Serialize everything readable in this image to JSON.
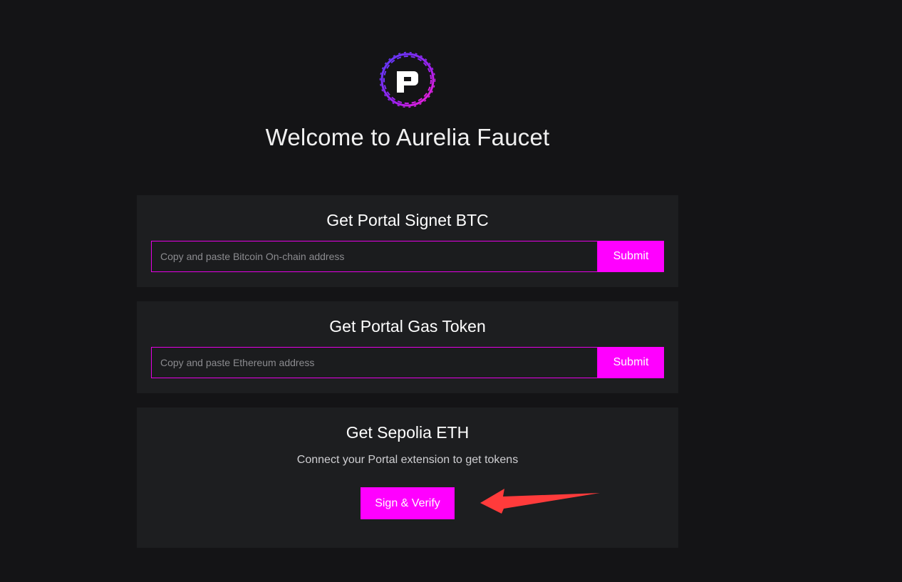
{
  "header": {
    "logo_icon": "portal-p-logo-icon",
    "title": "Welcome to Aurelia Faucet"
  },
  "cards": [
    {
      "title": "Get Portal Signet BTC",
      "input_placeholder": "Copy and paste Bitcoin On-chain address",
      "input_value": "",
      "button_label": "Submit"
    },
    {
      "title": "Get Portal Gas Token",
      "input_placeholder": "Copy and paste Ethereum address",
      "input_value": "",
      "button_label": "Submit"
    },
    {
      "title": "Get Sepolia ETH",
      "subtitle": "Connect your Portal extension to get tokens",
      "button_label": "Sign & Verify"
    }
  ],
  "annotation": {
    "icon": "red-arrow-icon",
    "color": "#ff3b3b"
  },
  "colors": {
    "accent": "#ff00ff",
    "background": "#141416",
    "card": "#1d1e20"
  }
}
